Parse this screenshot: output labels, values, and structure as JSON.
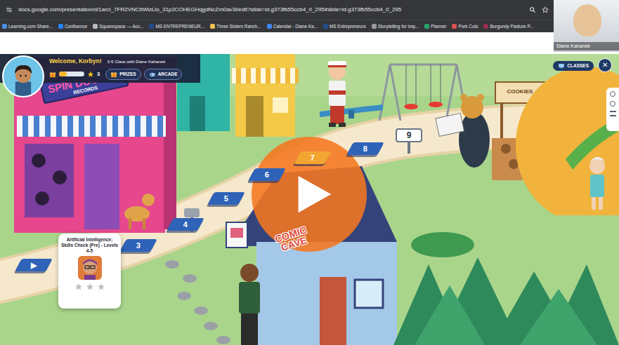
{
  "browser": {
    "url": "docs.google.com/presentation/d/1arcI_7FRZVNCttWlzLlo_31p2COHEGHqgdNcZm0av3I/edit?slide=id.g373fb55ccb4_0_295#slide=id.g373fb55ccb4_0_295",
    "bookmarks": [
      "Learning.com Share...",
      "Confluence",
      "Squarespace — Acc...",
      "MS ENTREPRENEUR...",
      "Three Sisters Ranch...",
      "Calendar - Diane Ka...",
      "MS Entrepreneurs",
      "Storytelling for Imp...",
      "Planner",
      "Pork Cuts",
      "Burgundy Pasture P..."
    ]
  },
  "presenter": {
    "name": "Diane Kahanek"
  },
  "game": {
    "welcome": "Welcome, Korbyn!",
    "class_name": "3-5 Class with Diane Kahanek",
    "progress": {
      "level": 0.3
    },
    "stars": "3",
    "buttons": [
      {
        "label": "PRIZES"
      },
      {
        "label": "ARCADE"
      }
    ],
    "classes_button": "CLASSES",
    "close": "✕"
  },
  "map": {
    "store_sign": "SPIN DOCTOR",
    "store_subsign": "RECORDS",
    "comic_sign": "COMIC CAVE",
    "cookie_sign": "COOKIES",
    "tiles": [
      {
        "label": "▶",
        "kind": "tile",
        "highlighted": false
      },
      {
        "label": "3",
        "kind": "tile",
        "highlighted": false
      },
      {
        "label": "4",
        "kind": "tile",
        "highlighted": false
      },
      {
        "label": "5",
        "kind": "tile",
        "highlighted": false
      },
      {
        "label": "6",
        "kind": "tile",
        "highlighted": false
      },
      {
        "label": "7",
        "kind": "tile",
        "highlighted": true
      },
      {
        "label": "8",
        "kind": "tile",
        "highlighted": false
      },
      {
        "label": "9",
        "kind": "signpost",
        "highlighted": false
      }
    ],
    "activity_card": {
      "title": "Artificial Intelligence: Skills Check (Pre) - Levels 4-5",
      "stars": 0
    }
  }
}
